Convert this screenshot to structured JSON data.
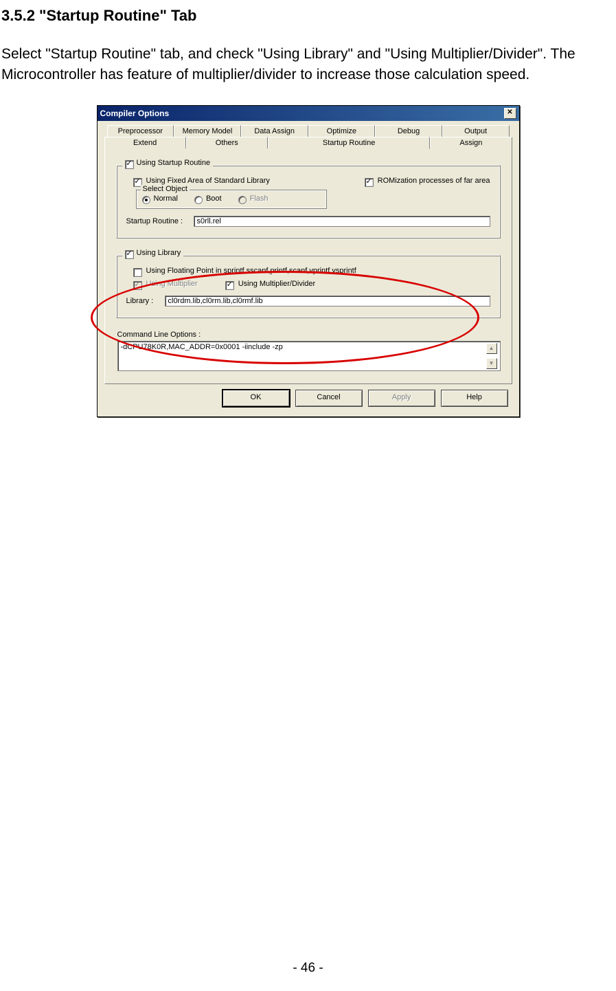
{
  "doc": {
    "heading": "3.5.2 \"Startup Routine\" Tab",
    "paragraph": "Select \"Startup Routine\" tab, and check \"Using Library\" and \"Using Multiplier/Divider\". The Microcontroller has feature of multiplier/divider to increase those calculation speed.",
    "page_number": "- 46 -"
  },
  "dialog": {
    "title": "Compiler Options",
    "close_glyph": "✕",
    "tabs_back": [
      "Preprocessor",
      "Memory Model",
      "Data Assign",
      "Optimize",
      "Debug",
      "Output"
    ],
    "tabs_front_left": [
      "Extend",
      "Others"
    ],
    "tabs_front_active": "Startup Routine",
    "tabs_front_right": [
      "Assign"
    ],
    "group1": {
      "title": "Using Startup Routine",
      "opt_fixed": "Using Fixed Area of Standard Library",
      "opt_rom": "ROMization processes of far area",
      "select_object_label": "Select Object",
      "radio_normal": "Normal",
      "radio_boot": "Boot",
      "radio_flash": "Flash",
      "startup_label": "Startup Routine :",
      "startup_value": "s0rll.rel"
    },
    "group2": {
      "title": "Using Library",
      "opt_float": "Using Floating Point in sprintf,sscanf,printf,scanf,vprintf,vsprintf",
      "opt_mult": "Using Multiplier",
      "opt_multdiv": "Using Multiplier/Divider",
      "library_label": "Library :",
      "library_value": "cl0rdm.lib,cl0rm.lib,cl0rmf.lib"
    },
    "cmdline": {
      "label": "Command Line Options :",
      "value": "-dCPU78K0R,MAC_ADDR=0x0001 -iinclude -zp"
    },
    "buttons": {
      "ok": "OK",
      "cancel": "Cancel",
      "apply": "Apply",
      "help": "Help"
    },
    "scroll_up": "▲",
    "scroll_down": "▼"
  }
}
